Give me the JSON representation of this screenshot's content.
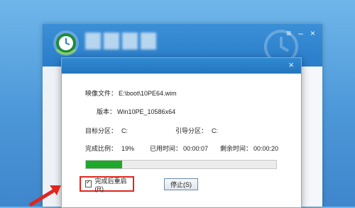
{
  "app": {
    "window_controls": {
      "menu": "≡",
      "minimize": "–",
      "close": "×"
    }
  },
  "dialog": {
    "close": "×",
    "image_file": {
      "label": "映像文件：",
      "value": "E:\\boot\\10PE64.wim"
    },
    "version": {
      "label": "版本：",
      "value": "Win10PE_10586x64"
    },
    "target_partition": {
      "label": "目标分区：",
      "value": "C:"
    },
    "boot_partition": {
      "label": "引导分区：",
      "value": "C:"
    },
    "completion": {
      "label": "完成比例：",
      "value": "19%"
    },
    "elapsed": {
      "label": "已用时间：",
      "value": "00:00:07"
    },
    "remaining": {
      "label": "剩余时间：",
      "value": "00:00:20"
    },
    "progress_fraction": 0.19,
    "restart_checkbox": {
      "label": "完成后重启(R)",
      "checked": true
    },
    "stop_button": "停止(S)"
  },
  "colors": {
    "progress": "#1fa82a",
    "highlight": "#e0261e",
    "titlebar": "#2a7dc9"
  }
}
